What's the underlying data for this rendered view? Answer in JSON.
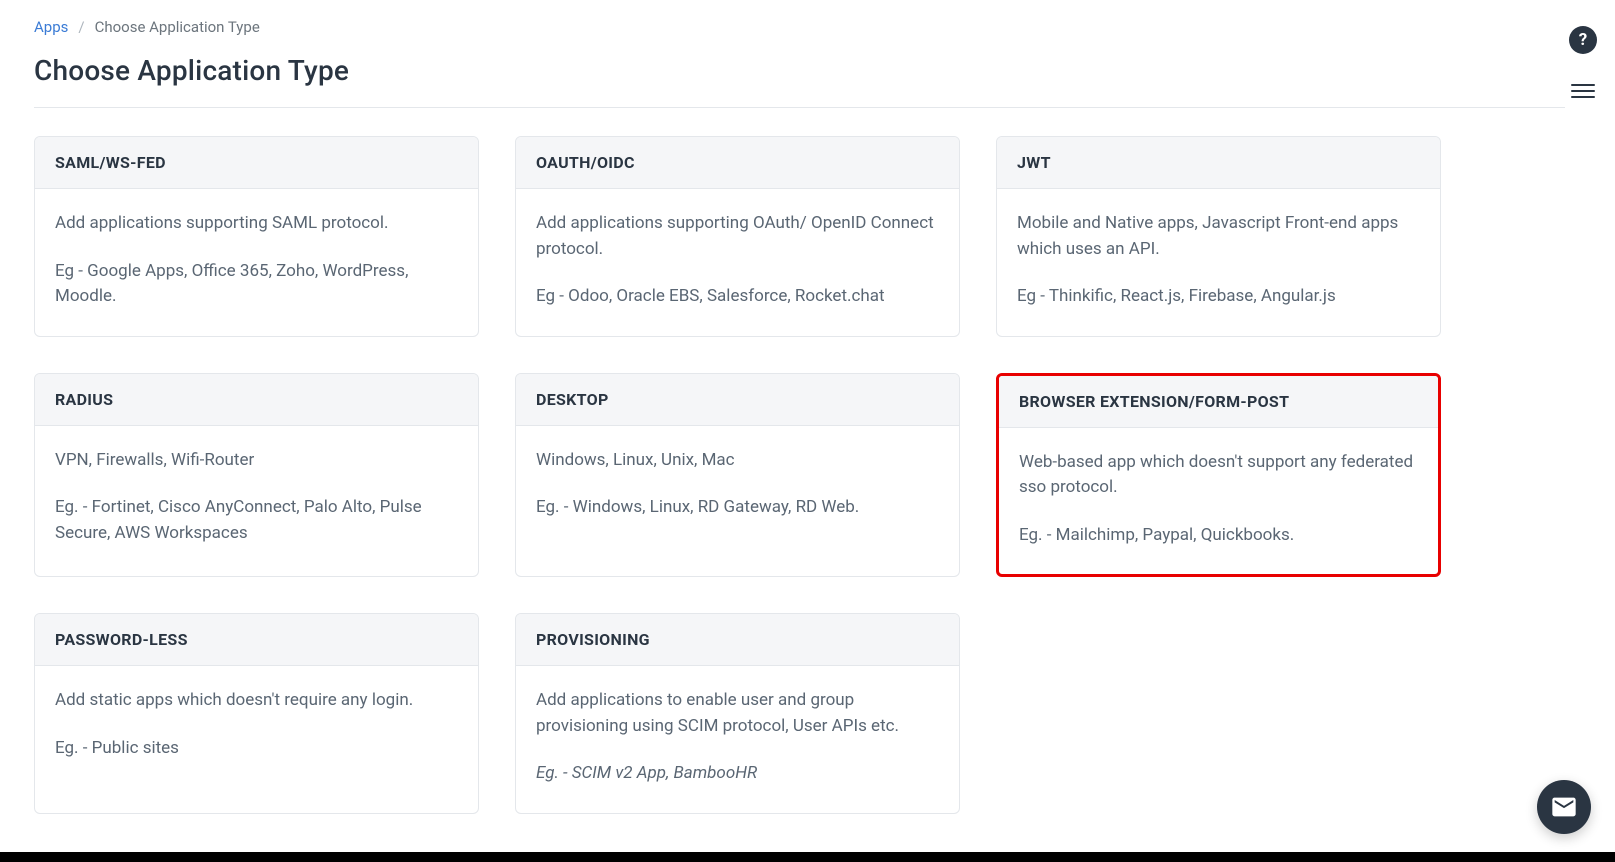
{
  "breadcrumb": {
    "root": "Apps",
    "current": "Choose Application Type"
  },
  "page_title": "Choose Application Type",
  "cards": [
    {
      "title": "SAML/WS-FED",
      "desc": "Add applications supporting SAML protocol.",
      "eg": "Eg - Google Apps, Office 365, Zoho, WordPress, Moodle.",
      "italic": false,
      "highlight": false
    },
    {
      "title": "OAUTH/OIDC",
      "desc": "Add applications supporting OAuth/ OpenID Connect protocol.",
      "eg": "Eg - Odoo, Oracle EBS, Salesforce, Rocket.chat",
      "italic": false,
      "highlight": false
    },
    {
      "title": "JWT",
      "desc": "Mobile and Native apps, Javascript Front-end apps which uses an API.",
      "eg": "Eg - Thinkific, React.js, Firebase, Angular.js",
      "italic": false,
      "highlight": false
    },
    {
      "title": "RADIUS",
      "desc": "VPN, Firewalls, Wifi-Router",
      "eg": "Eg. - Fortinet, Cisco AnyConnect, Palo Alto, Pulse Secure, AWS Workspaces",
      "italic": false,
      "highlight": false
    },
    {
      "title": "DESKTOP",
      "desc": "Windows, Linux, Unix, Mac",
      "eg": "Eg. - Windows, Linux, RD Gateway, RD Web.",
      "italic": false,
      "highlight": false
    },
    {
      "title": "BROWSER EXTENSION/FORM-POST",
      "desc": "Web-based app which doesn't support any federated sso protocol.",
      "eg": "Eg. - Mailchimp, Paypal, Quickbooks.",
      "italic": false,
      "highlight": true
    },
    {
      "title": "PASSWORD-LESS",
      "desc": "Add static apps which doesn't require any login.",
      "eg": "Eg. - Public sites",
      "italic": false,
      "highlight": false
    },
    {
      "title": "PROVISIONING",
      "desc": "Add applications to enable user and group provisioning using SCIM protocol, User APIs etc.",
      "eg": "Eg. - SCIM v2 App, BambooHR",
      "italic": true,
      "highlight": false
    }
  ],
  "help_label": "?",
  "colors": {
    "highlight_border": "#e80000",
    "link": "#3a7bd5",
    "text_primary": "#2a3542",
    "text_secondary": "#5a6673"
  }
}
